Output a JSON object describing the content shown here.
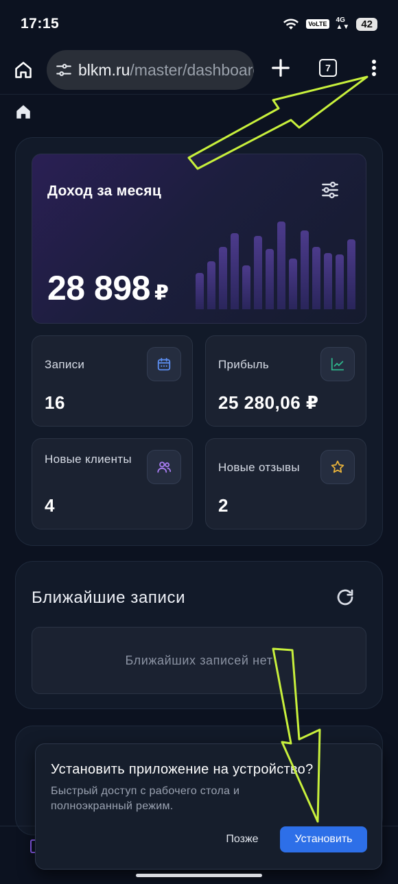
{
  "status_bar": {
    "time": "17:15",
    "volte": "VoLTE",
    "network": "4G",
    "battery": "42"
  },
  "browser": {
    "url_host": "blkm.ru",
    "url_path": "/master/dashboard",
    "tab_count": "7",
    "icons": {
      "home": "home-icon",
      "site_settings": "tune-icon",
      "new_tab": "plus-icon",
      "menu": "more-vert-icon"
    }
  },
  "income": {
    "title": "Доход за месяц",
    "value": "28 898",
    "currency": "₽",
    "bar_levels": [
      0.36,
      0.48,
      0.62,
      0.76,
      0.44,
      0.73,
      0.6,
      0.88,
      0.51,
      0.79,
      0.62,
      0.56,
      0.55,
      0.7
    ]
  },
  "stats": [
    {
      "label": "Записи",
      "value": "16",
      "icon": "calendar-icon",
      "color": "#5b8def"
    },
    {
      "label": "Прибыль",
      "value": "25 280,06 ₽",
      "icon": "trending-up-icon",
      "color": "#2fb38a"
    },
    {
      "label": "Новые клиенты",
      "value": "4",
      "icon": "users-icon",
      "color": "#a87cf2"
    },
    {
      "label": "Новые отзывы",
      "value": "2",
      "icon": "star-icon",
      "color": "#e8b23a"
    }
  ],
  "upcoming": {
    "title": "Ближайшие записи",
    "empty_text": "Ближайших записей нет"
  },
  "install_prompt": {
    "title": "Установить приложение на устройство?",
    "text": "Быстрый доступ с рабочего стола и полноэкранный режим.",
    "later_label": "Позже",
    "install_label": "Установить"
  },
  "colors": {
    "background": "#0c1220",
    "accent": "#2d6fe8",
    "annotation_arrow": "#c8f03c"
  }
}
